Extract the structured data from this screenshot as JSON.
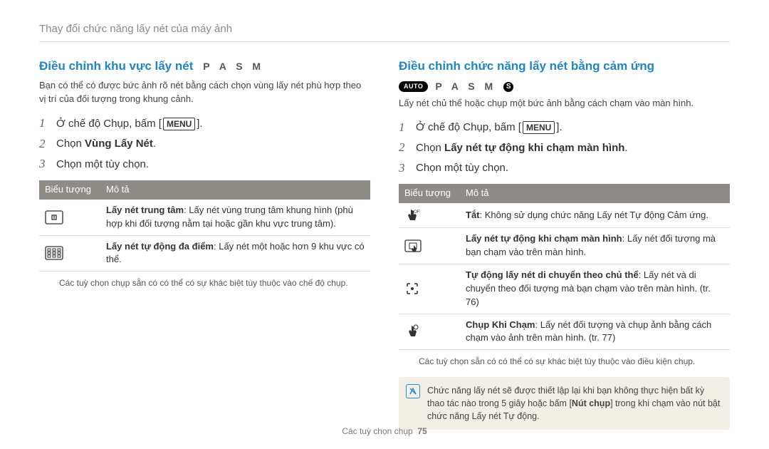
{
  "header": "Thay đổi chức năng lấy nét của máy ảnh",
  "left": {
    "title": "Điều chỉnh khu vực lấy nét",
    "modes": "P A S M",
    "intro": "Bạn có thể có được bức ảnh rõ nét bằng cách chọn vùng lấy nét phù hợp theo vị trí của đối tượng trong khung cảnh.",
    "steps": {
      "s1_pre": "Ở chế độ Chụp, bấm [",
      "s1_menu": "MENU",
      "s1_post": "].",
      "s2_pre": "Chọn ",
      "s2_bold": "Vùng Lấy Nét",
      "s2_post": ".",
      "s3": "Chọn một tùy chọn."
    },
    "th1": "Biểu tượng",
    "th2": "Mô tả",
    "row1_b": "Lấy nét trung tâm",
    "row1_t": ": Lấy nét vùng trung tâm khung hình (phù hợp khi đối tượng nằm tại hoặc gần khu vực trung tâm).",
    "row2_b": "Lấy nét tự động đa điểm",
    "row2_t": ": Lấy nét một hoặc hơn 9 khu vực có thể.",
    "note": "Các tuỳ chọn chụp sẵn có có thể có sự khác biệt tùy thuộc vào chế độ chụp."
  },
  "right": {
    "title": "Điều chỉnh chức năng lấy nét bằng cảm ứng",
    "pill_auto": "AUTO",
    "modes": "P A S M",
    "pill_s": "S",
    "intro": "Lấy nét chủ thể hoặc chụp một bức ảnh bằng cách chạm vào màn hình.",
    "steps": {
      "s1_pre": "Ở chế độ Chụp, bấm [",
      "s1_menu": "MENU",
      "s1_post": "].",
      "s2_pre": "Chọn ",
      "s2_bold": "Lấy nét tự động khi chạm màn hình",
      "s2_post": ".",
      "s3": "Chọn một tùy chọn."
    },
    "th1": "Biểu tượng",
    "th2": "Mô tả",
    "row1_b": "Tắt",
    "row1_t": ": Không sử dụng chức năng Lấy nét Tự động Cảm ứng.",
    "row2_b": "Lấy nét tự động khi chạm màn hình",
    "row2_t": ": Lấy nét đối tượng mà bạn chạm vào trên màn hình.",
    "row3_b": "Tự động lấy nét di chuyển theo chủ thể",
    "row3_t": ": Lấy nét và di chuyển theo đối tượng mà bạn chạm vào trên màn hình. (tr. 76)",
    "row4_b": "Chụp Khi Chạm",
    "row4_t": ": Lấy nét đối tượng và chụp ảnh bằng cách chạm vào ảnh trên màn hình. (tr. 77)",
    "note": "Các tuỳ chọn sẵn có có thể có sự khác biệt tùy thuộc vào điều kiện chụp.",
    "tip_pre": "Chức năng lấy nét sẽ được thiết lập lại khi bạn không thực hiện bất kỳ thao tác nào trong 5 giây hoặc bấm [",
    "tip_bold": "Nút chụp",
    "tip_post": "] trong khi chạm vào nút bật chức năng Lấy nét Tự động."
  },
  "footer_label": "Các tuỳ chọn chụp",
  "footer_page": "75"
}
